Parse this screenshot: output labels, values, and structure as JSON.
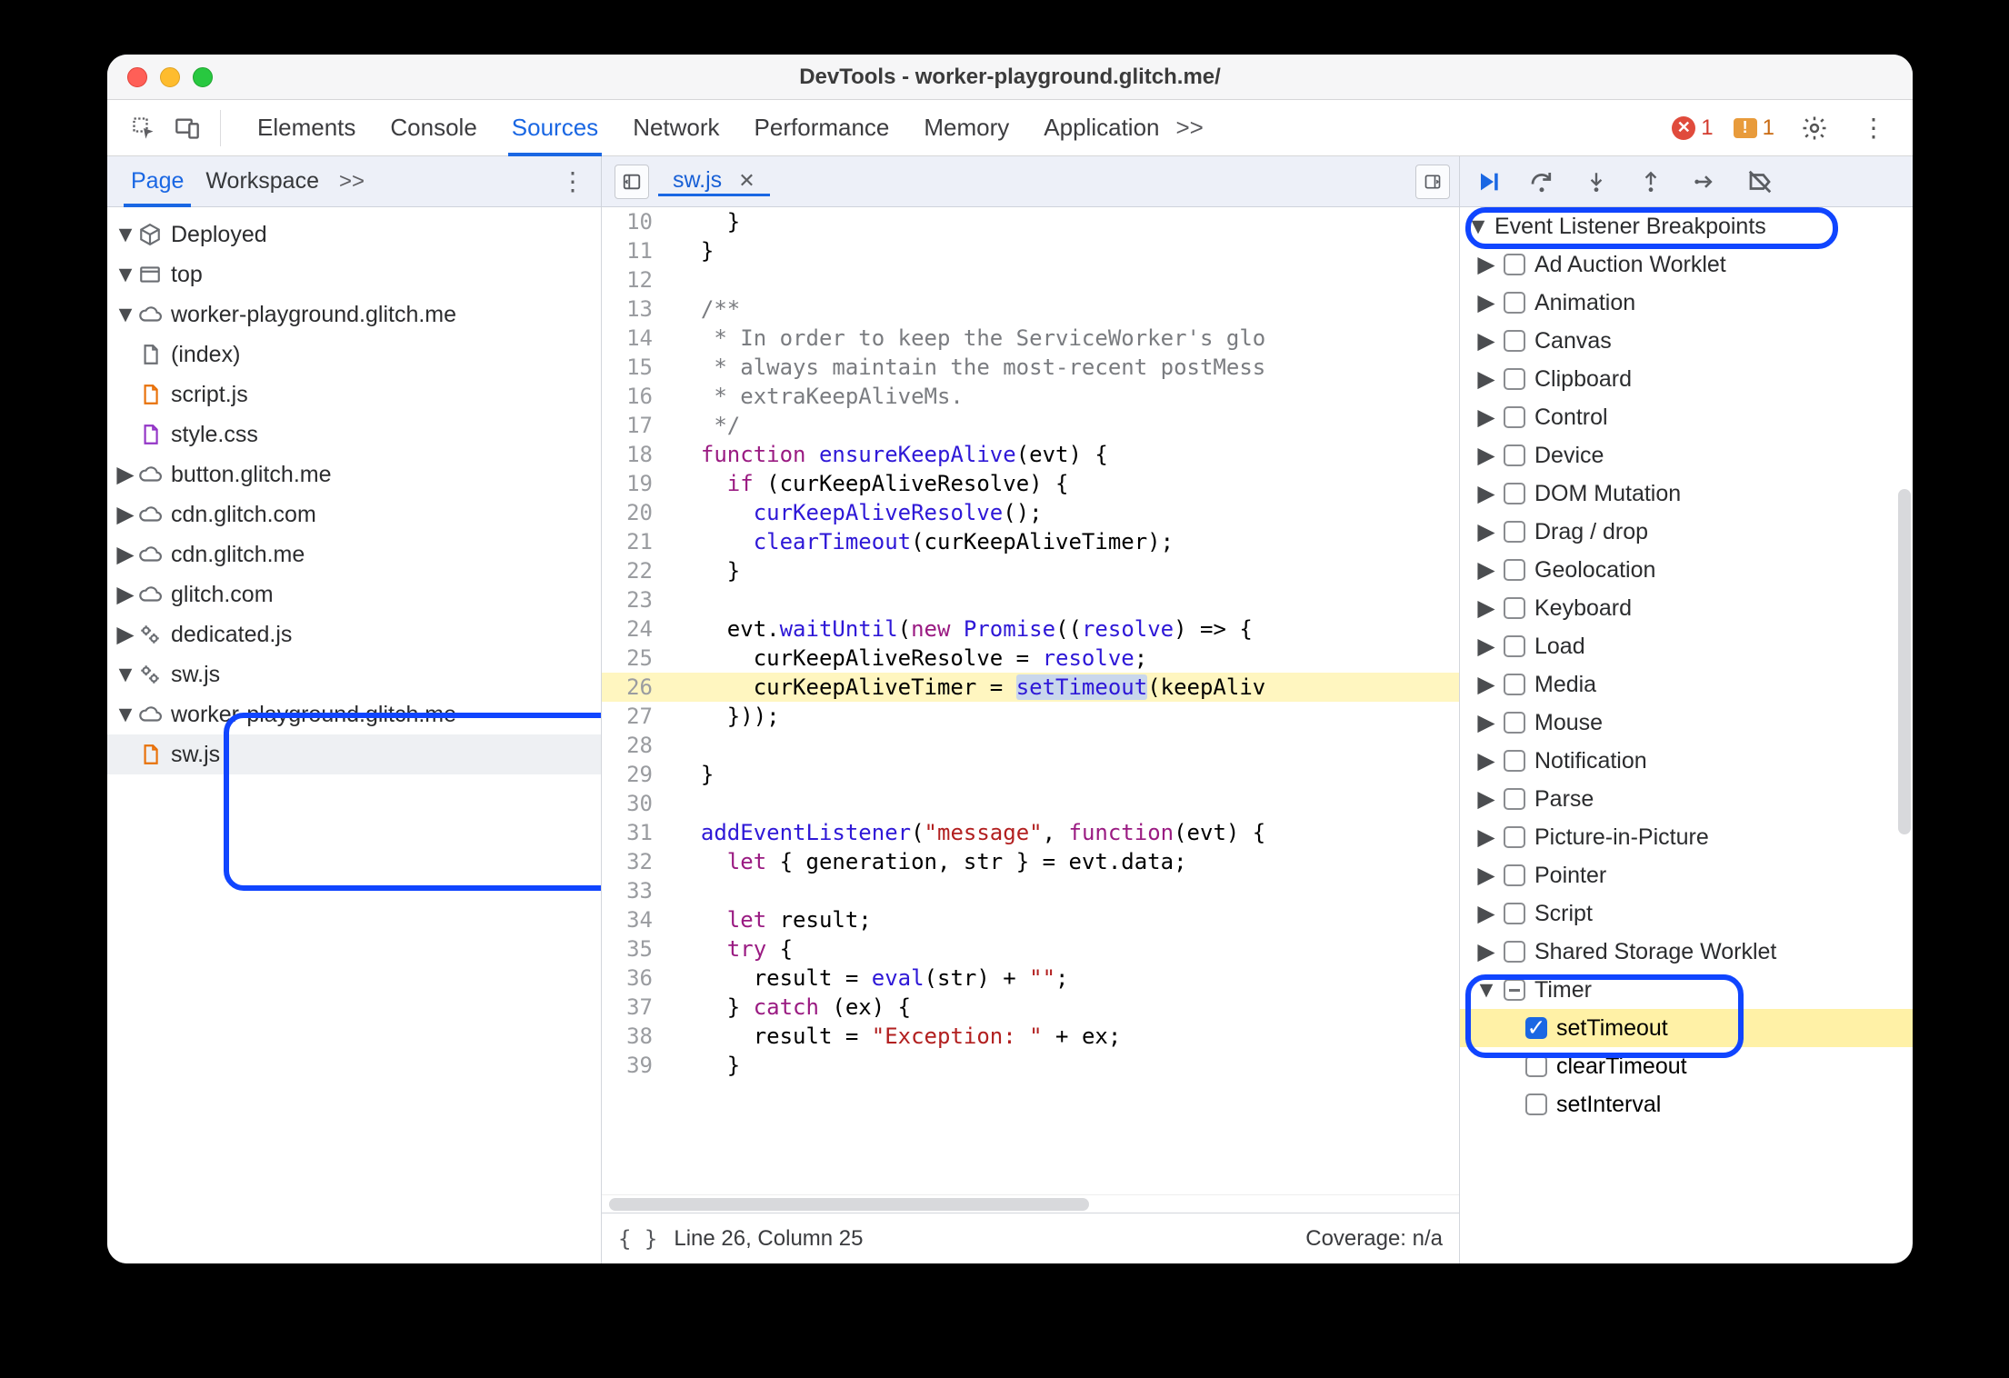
{
  "window": {
    "title": "DevTools - worker-playground.glitch.me/"
  },
  "mainTabs": {
    "items": [
      "Elements",
      "Console",
      "Sources",
      "Network",
      "Performance",
      "Memory",
      "Application"
    ],
    "activeIndex": 2,
    "more": ">>",
    "errorsCount": "1",
    "warningsCount": "1"
  },
  "subTabs": {
    "left": [
      "Page",
      "Workspace"
    ],
    "leftActiveIndex": 0,
    "more": ">>",
    "openFile": "sw.js"
  },
  "tree": {
    "root": "Deployed",
    "top": "top",
    "origin1": "worker-playground.glitch.me",
    "files1": [
      "(index)",
      "script.js",
      "style.css"
    ],
    "origins2": [
      "button.glitch.me",
      "cdn.glitch.com",
      "cdn.glitch.me",
      "glitch.com"
    ],
    "dedicated": "dedicated.js",
    "swRoot": "sw.js",
    "swOrigin": "worker-playground.glitch.me",
    "swFile": "sw.js"
  },
  "code": {
    "startLine": 10,
    "highlightLine": 26,
    "lines": [
      "    }",
      "  }",
      "",
      "  /**",
      "   * In order to keep the ServiceWorker's glo",
      "   * always maintain the most-recent postMess",
      "   * extraKeepAliveMs.",
      "   */",
      "  function ensureKeepAlive(evt) {",
      "    if (curKeepAliveResolve) {",
      "      curKeepAliveResolve();",
      "      clearTimeout(curKeepAliveTimer);",
      "    }",
      "",
      "    evt.waitUntil(new Promise((resolve) => {",
      "      curKeepAliveResolve = resolve;",
      "      curKeepAliveTimer = setTimeout(keepAliv",
      "    }));",
      "",
      "  }",
      "",
      "  addEventListener(\"message\", function(evt) {",
      "    let { generation, str } = evt.data;",
      "",
      "    let result;",
      "    try {",
      "      result = eval(str) + \"\";",
      "    } catch (ex) {",
      "      result = \"Exception: \" + ex;",
      "    }"
    ]
  },
  "status": {
    "pos": "Line 26, Column 25",
    "coverage": "Coverage: n/a"
  },
  "breakpoints": {
    "header": "Event Listener Breakpoints",
    "categories": [
      "Ad Auction Worklet",
      "Animation",
      "Canvas",
      "Clipboard",
      "Control",
      "Device",
      "DOM Mutation",
      "Drag / drop",
      "Geolocation",
      "Keyboard",
      "Load",
      "Media",
      "Mouse",
      "Notification",
      "Parse",
      "Picture-in-Picture",
      "Pointer",
      "Script",
      "Shared Storage Worklet"
    ],
    "timer": {
      "label": "Timer",
      "items": [
        "setTimeout",
        "clearTimeout",
        "setInterval"
      ],
      "checked": [
        true,
        false,
        false
      ]
    }
  }
}
